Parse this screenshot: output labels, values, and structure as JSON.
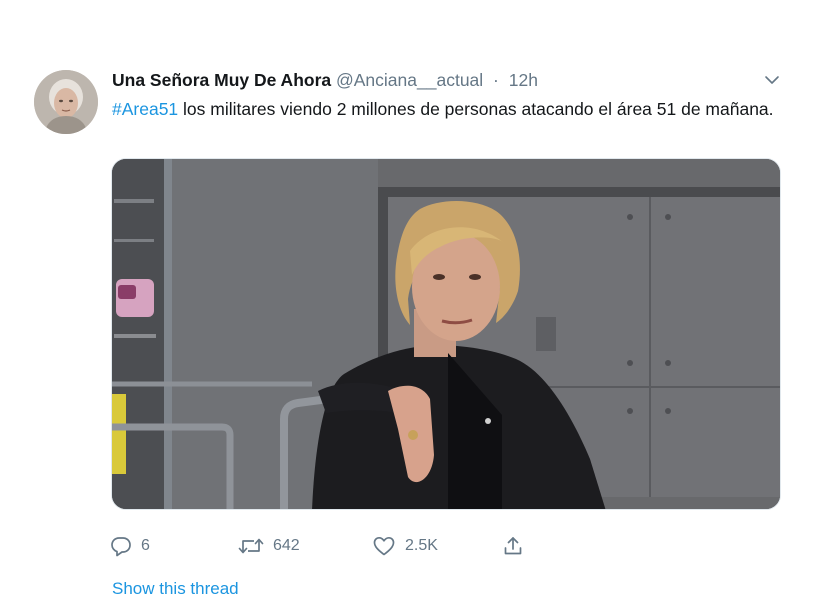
{
  "tweet": {
    "author_name": "Una Señora Muy De Ahora",
    "handle": "@Anciana__actual",
    "separator": "·",
    "time": "12h",
    "hashtag": "#Area51",
    "text": " los militares viendo 2 millones de personas atacando el área 51 de mañana.",
    "avatar_icon": "profile-photo",
    "caret_icon": "chevron-down-icon"
  },
  "actions": {
    "reply_count": "6",
    "retweet_count": "642",
    "like_count": "2.5K",
    "share_icon": "share-icon"
  },
  "footer": {
    "show_thread": "Show this thread"
  },
  "colors": {
    "link": "#1b95e0",
    "secondary_text": "#657786",
    "primary_text": "#14171a"
  }
}
